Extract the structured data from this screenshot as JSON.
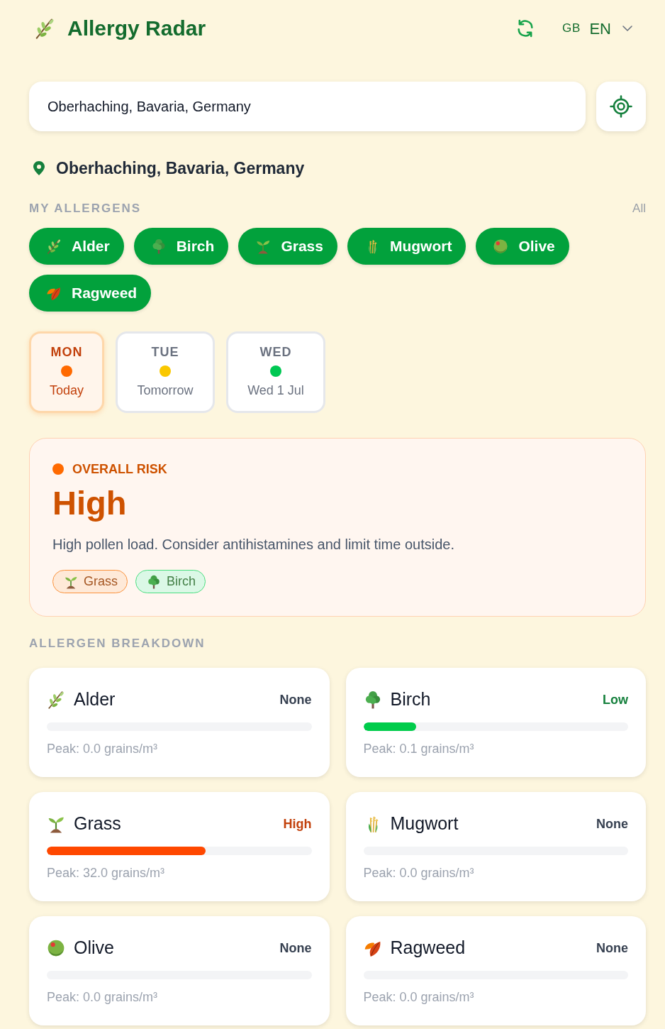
{
  "header": {
    "title": "Allergy Radar",
    "language": {
      "flag": "GB",
      "code": "EN"
    }
  },
  "search": {
    "value": "Oberhaching, Bavaria, Germany"
  },
  "location": "Oberhaching, Bavaria, Germany",
  "my_allergens": {
    "heading": "MY ALLERGENS",
    "link": "All",
    "chips": [
      {
        "label": "Alder",
        "kind": "herb",
        "selected": true
      },
      {
        "label": "Birch",
        "kind": "tree",
        "selected": true
      },
      {
        "label": "Grass",
        "kind": "seedling",
        "selected": true
      },
      {
        "label": "Mugwort",
        "kind": "sheaf",
        "selected": true
      },
      {
        "label": "Olive",
        "kind": "olive",
        "selected": true
      },
      {
        "label": "Ragweed",
        "kind": "leaves",
        "selected": true
      }
    ]
  },
  "days": [
    {
      "label": "MON",
      "sub": "Today",
      "color": "#ff6a00",
      "selected": true
    },
    {
      "label": "TUE",
      "sub": "Tomorrow",
      "color": "#fac800",
      "selected": false
    },
    {
      "label": "WED",
      "sub": "Wed 1 Jul",
      "color": "#00c853",
      "selected": false
    }
  ],
  "overall": {
    "label": "OVERALL RISK",
    "value": "High",
    "color": "#ff6a00",
    "message": "High pollen load. Consider antihistamines and limit time outside.",
    "tags": [
      {
        "label": "Grass",
        "kind": "seedling",
        "color": "#fb923c"
      },
      {
        "label": "Birch",
        "kind": "tree",
        "color": "#4ade80"
      }
    ]
  },
  "breakdown": {
    "heading": "ALLERGEN BREAKDOWN",
    "cards": [
      {
        "name": "Alder",
        "kind": "herb",
        "rating": "None",
        "color": "#374151",
        "level": 0,
        "peak": "Peak: 0.0 grains/m³"
      },
      {
        "name": "Birch",
        "kind": "tree",
        "rating": "Low",
        "color": "#15803d",
        "level": 0.2,
        "peak": "Peak: 0.1 grains/m³"
      },
      {
        "name": "Grass",
        "kind": "seedling",
        "rating": "High",
        "color": "#c2410c",
        "level": 0.6,
        "peak": "Peak: 32.0 grains/m³"
      },
      {
        "name": "Mugwort",
        "kind": "sheaf",
        "rating": "None",
        "color": "#374151",
        "level": 0,
        "peak": "Peak: 0.0 grains/m³"
      },
      {
        "name": "Olive",
        "kind": "olive",
        "rating": "None",
        "color": "#374151",
        "level": 0,
        "peak": "Peak: 0.0 grains/m³"
      },
      {
        "name": "Ragweed",
        "kind": "leaves",
        "rating": "None",
        "color": "#374151",
        "level": 0,
        "peak": "Peak: 0.0 grains/m³"
      }
    ]
  }
}
